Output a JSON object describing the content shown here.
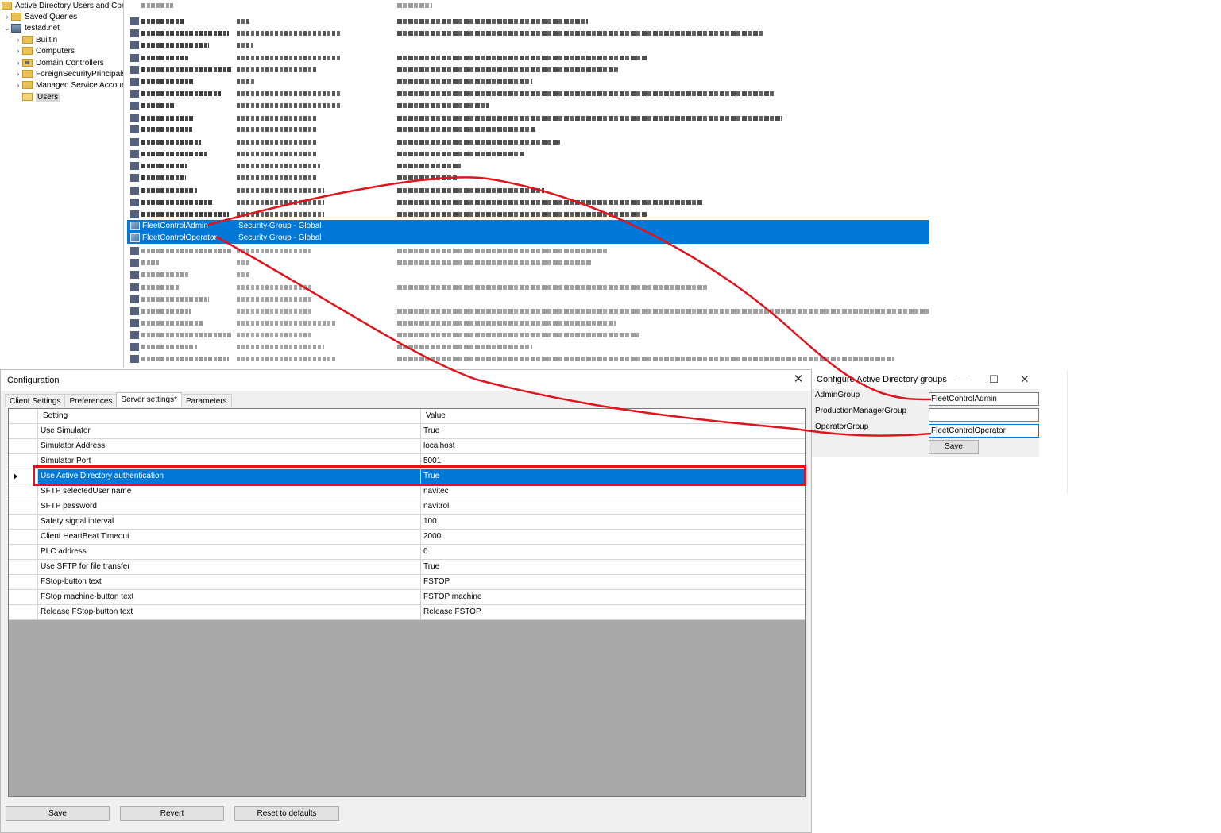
{
  "ad": {
    "tree": [
      {
        "label": "Active Directory Users and Com",
        "toggle": "",
        "icon": "snapin-icon"
      },
      {
        "label": "Saved Queries",
        "toggle": "›",
        "icon": "folder-icon"
      },
      {
        "label": "testad.net",
        "toggle": "⌄",
        "icon": "domain-icon"
      },
      {
        "label": "Builtin",
        "toggle": "›",
        "icon": "folder-icon"
      },
      {
        "label": "Computers",
        "toggle": "›",
        "icon": "folder-icon"
      },
      {
        "label": "Domain Controllers",
        "toggle": "›",
        "icon": "folder-icon"
      },
      {
        "label": "ForeignSecurityPrincipals",
        "toggle": "›",
        "icon": "folder-icon"
      },
      {
        "label": "Managed Service Accour",
        "toggle": "›",
        "icon": "folder-icon"
      },
      {
        "label": "Users",
        "toggle": "",
        "icon": "folder-icon"
      }
    ],
    "selected_rows": [
      {
        "name": "FleetControlAdmin",
        "type": "Security Group - Global"
      },
      {
        "name": "FleetControlOperator",
        "type": "Security Group - Global"
      }
    ]
  },
  "config": {
    "title": "Configuration",
    "close_glyph": "✕",
    "tabs": [
      {
        "label": "Client Settings"
      },
      {
        "label": "Preferences"
      },
      {
        "label": "Server settings*"
      },
      {
        "label": "Parameters"
      }
    ],
    "grid": {
      "headers": {
        "setting": "Setting",
        "value": "Value"
      },
      "rows": [
        {
          "setting": "Use Simulator",
          "value": "True"
        },
        {
          "setting": "Simulator Address",
          "value": "localhost"
        },
        {
          "setting": "Simulator Port",
          "value": "5001"
        },
        {
          "setting": "Use Active Directory authentication",
          "value": "True"
        },
        {
          "setting": "SFTP selectedUser name",
          "value": "navitec"
        },
        {
          "setting": "SFTP password",
          "value": "navitrol"
        },
        {
          "setting": "Safety signal interval",
          "value": "100"
        },
        {
          "setting": "Client HeartBeat Timeout",
          "value": "2000"
        },
        {
          "setting": "PLC address",
          "value": "0"
        },
        {
          "setting": "Use SFTP for file transfer",
          "value": "True"
        },
        {
          "setting": "FStop-button text",
          "value": "FSTOP"
        },
        {
          "setting": "FStop machine-button text",
          "value": "FSTOP machine"
        },
        {
          "setting": "Release FStop-button text",
          "value": "Release FSTOP"
        }
      ]
    },
    "buttons": {
      "save": "Save",
      "revert": "Revert",
      "reset": "Reset to defaults"
    }
  },
  "groups_dialog": {
    "title": "Configure Active Directory groups",
    "minimize_glyph": "—",
    "maximize_glyph": "☐",
    "close_glyph": "✕",
    "fields": [
      {
        "label": "AdminGroup",
        "value": "FleetControlAdmin"
      },
      {
        "label": "ProductionManagerGroup",
        "value": ""
      },
      {
        "label": "OperatorGroup",
        "value": "FleetControlOperator"
      }
    ],
    "save": "Save"
  },
  "colors": {
    "selection": "#0078d7",
    "annotation": "#e0141e"
  }
}
